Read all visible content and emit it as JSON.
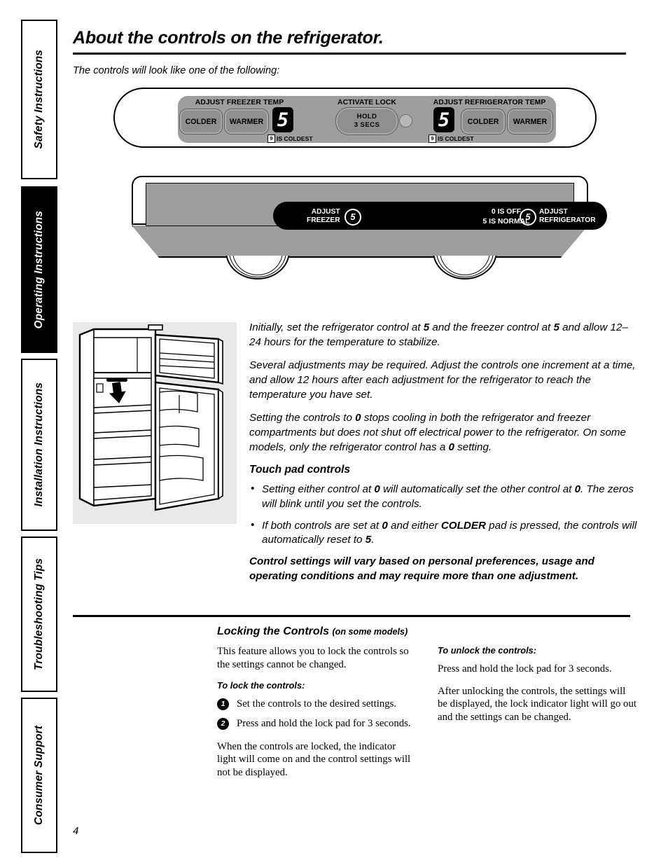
{
  "sidebar": {
    "tabs": [
      {
        "label": "Safety Instructions",
        "active": false
      },
      {
        "label": "Operating Instructions",
        "active": true
      },
      {
        "label": "Installation Instructions",
        "active": false
      },
      {
        "label": "Troubleshooting Tips",
        "active": false
      },
      {
        "label": "Consumer Support",
        "active": false
      }
    ]
  },
  "page": {
    "title": "About the controls on the refrigerator.",
    "intro": "The controls will look like one of the following:",
    "number": "4"
  },
  "panel_touchpad": {
    "freezer_group_label": "ADJUST FREEZER TEMP",
    "lock_group_label": "ACTIVATE LOCK",
    "refrigerator_group_label": "ADJUST REFRIGERATOR TEMP",
    "freezer_colder": "COLDER",
    "freezer_warmer": "WARMER",
    "freezer_display": "5",
    "freezer_coldest_digit": "9",
    "freezer_coldest_text": "IS COLDEST",
    "lock_line1": "HOLD",
    "lock_line2": "3 SECS",
    "refrigerator_display": "5",
    "refrigerator_coldest_digit": "9",
    "refrigerator_coldest_text": "IS COLDEST",
    "refrigerator_colder": "COLDER",
    "refrigerator_warmer": "WARMER"
  },
  "panel_knob": {
    "freezer_line1": "ADJUST",
    "freezer_line2": "FREEZER",
    "freezer_value": "5",
    "legend_line1": "0 IS OFF",
    "legend_line2": "5 IS NORMAL",
    "refrigerator_value": "5",
    "refrigerator_line1": "ADJUST",
    "refrigerator_line2": "REFRIGERATOR"
  },
  "body": {
    "para1_a": "Initially, set the refrigerator control at ",
    "para1_b": "5",
    "para1_c": " and the freezer control at ",
    "para1_d": "5",
    "para1_e": " and allow 12–24 hours for the temperature to stabilize.",
    "para2": "Several adjustments may be required. Adjust the controls one increment at a time, and allow 12 hours after each adjustment for the refrigerator to reach the temperature you have set.",
    "para3_a": "Setting the controls to ",
    "para3_b": "0",
    "para3_c": " stops cooling in both the refrigerator and freezer compartments but does not shut off electrical power to the refrigerator. On some models, only the refrigerator control has a ",
    "para3_d": "0",
    "para3_e": " setting.",
    "touchpad_heading": "Touch pad controls",
    "bullet1_a": "Setting either control at ",
    "bullet1_b": "0",
    "bullet1_c": " will automatically set the other control at ",
    "bullet1_d": "0",
    "bullet1_e": ". The zeros will blink until you set the controls.",
    "bullet2_a": "If both controls are set at ",
    "bullet2_b": "0",
    "bullet2_c": " and either ",
    "bullet2_d": "COLDER",
    "bullet2_e": " pad is pressed, the controls will automatically reset to ",
    "bullet2_f": "5",
    "bullet2_g": ".",
    "closing": "Control settings will vary based on personal preferences, usage and operating conditions and may require more than one adjustment."
  },
  "locking": {
    "heading": "Locking the Controls",
    "heading_note": "(on some models)",
    "intro": "This feature allows you to lock the controls so the settings cannot be changed.",
    "lock_subhead": "To lock the controls:",
    "step1_num": "1",
    "step1_text": "Set the controls to the desired settings.",
    "step2_num": "2",
    "step2_text": "Press and hold the lock pad for 3 seconds.",
    "lock_note": "When the controls are locked, the indicator light will come on and the control settings will not be displayed.",
    "unlock_subhead": "To unlock the controls:",
    "unlock_text1": "Press and hold the lock pad for 3 seconds.",
    "unlock_text2": "After unlocking the controls, the settings will be displayed, the lock indicator light will go out and the settings can be changed."
  }
}
